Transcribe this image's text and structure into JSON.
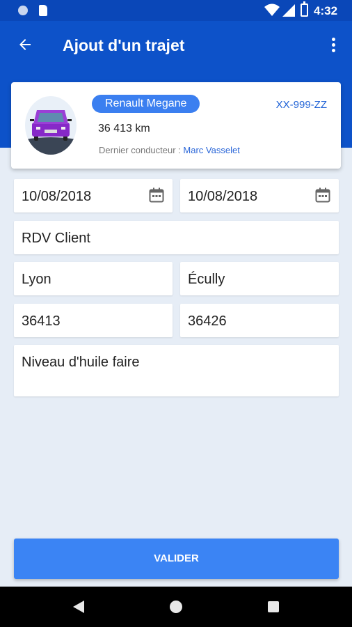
{
  "status_bar": {
    "time": "4:32"
  },
  "app_bar": {
    "title": "Ajout d'un trajet"
  },
  "vehicle": {
    "name": "Renault Megane",
    "plate": "XX-999-ZZ",
    "mileage": "36 413 km",
    "driver_label": "Dernier conducteur : ",
    "driver_name": "Marc Vasselet"
  },
  "form": {
    "start_date": "10/08/2018",
    "end_date": "10/08/2018",
    "reason": "RDV Client",
    "departure": "Lyon",
    "arrival": "Écully",
    "start_km": "36413",
    "end_km": "36426",
    "comment": "Niveau d'huile faire"
  },
  "submit_label": "VALIDER",
  "colors": {
    "primary": "#0d52c9",
    "accent": "#3b84f4",
    "badge": "#3b7ff0",
    "background": "#e6edf6"
  }
}
